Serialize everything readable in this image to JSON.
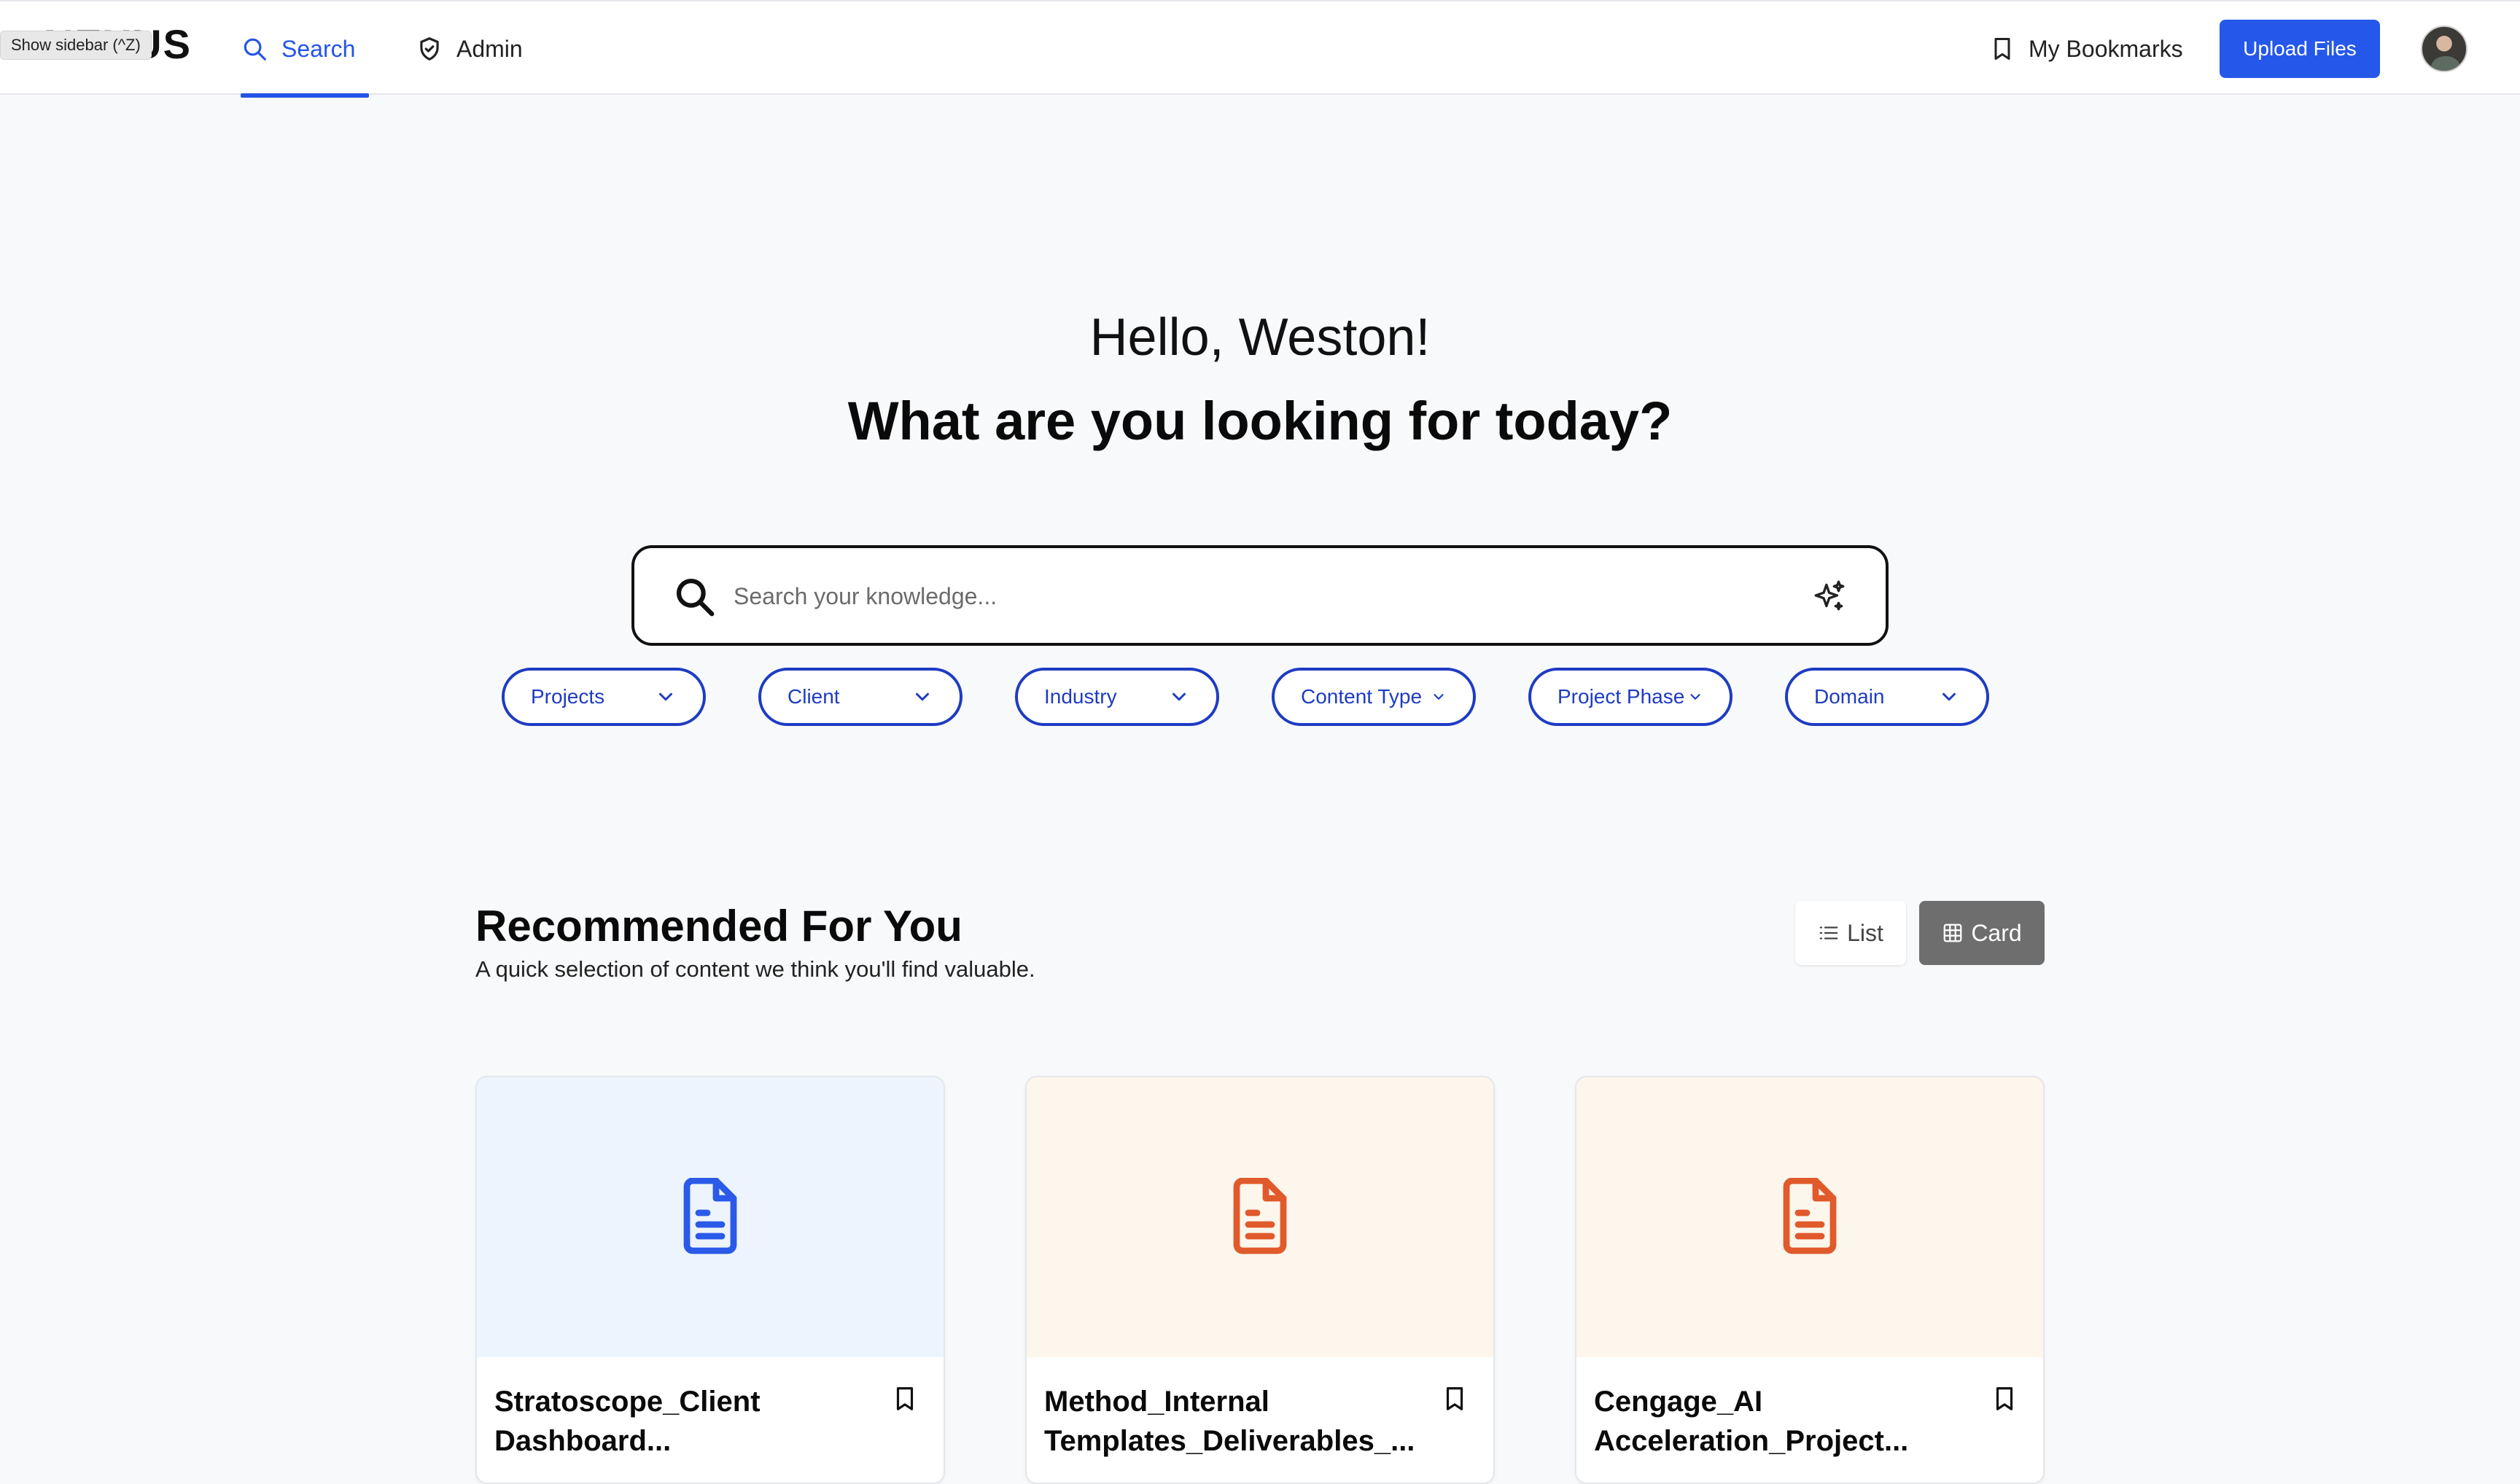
{
  "header": {
    "logo_text": "NEXUS",
    "tooltip": "Show sidebar (^Z)",
    "tabs": [
      {
        "label": "Search",
        "icon": "search-icon",
        "active": true
      },
      {
        "label": "Admin",
        "icon": "shield-icon",
        "active": false
      }
    ],
    "bookmarks_label": "My Bookmarks",
    "upload_label": "Upload Files"
  },
  "hero": {
    "greeting": "Hello, Weston!",
    "question": "What are you looking for today?"
  },
  "search": {
    "placeholder": "Search your knowledge...",
    "value": ""
  },
  "filters": [
    {
      "label": "Projects"
    },
    {
      "label": "Client"
    },
    {
      "label": "Industry"
    },
    {
      "label": "Content Type"
    },
    {
      "label": "Project Phase"
    },
    {
      "label": "Domain"
    }
  ],
  "recommended": {
    "title": "Recommended For You",
    "subtitle": "A quick selection of content we think you'll find valuable.",
    "view_list_label": "List",
    "view_card_label": "Card",
    "active_view": "Card",
    "cards": [
      {
        "title": "Stratoscope_Client Dashboard...",
        "icon_color": "#2b5ae8",
        "bg": "#edf4fd"
      },
      {
        "title": "Method_Internal Templates_Deliverables_...",
        "icon_color": "#e05a2b",
        "bg": "#fdf6ec"
      },
      {
        "title": "Cengage_AI Acceleration_Project...",
        "icon_color": "#e05a2b",
        "bg": "#fdf6ec"
      }
    ]
  },
  "colors": {
    "accent": "#2557ea",
    "filter_border": "#1e3cc2",
    "card_view_active": "#6e6e6e"
  }
}
